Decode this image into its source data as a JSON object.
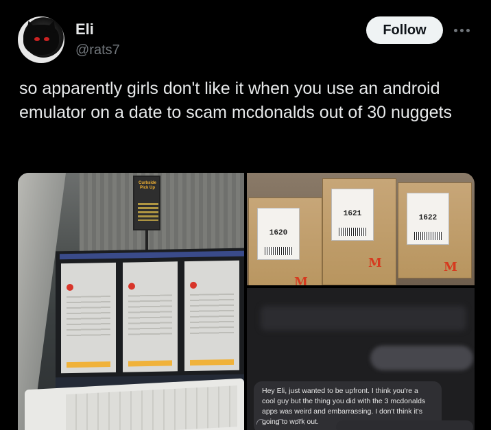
{
  "post": {
    "author_name": "Eli",
    "author_handle": "@rats7",
    "follow_label": "Follow",
    "more_icon": "more-horizontal-icon",
    "text": "so apparently girls don't like it when you use an android emulator on a date to scam mcdonalds out of 30 nuggets"
  },
  "media": {
    "left_photo": {
      "sign_text": "Curbside Pick Up"
    },
    "bags_photo": {
      "order_numbers": [
        "1620",
        "1621",
        "1622"
      ],
      "logo_glyph": "M"
    },
    "chat_photo": {
      "message": "Hey Eli, just wanted to be upfront. I think you're a cool guy but the thing you did with the 3 mcdonalds apps was weird and embarrassing. I don't think it's going to work out."
    }
  },
  "colors": {
    "background": "#000000",
    "text_primary": "#e7e9ea",
    "text_secondary": "#71767b",
    "follow_bg": "#eff3f4",
    "mcdonalds_red": "#d63a1f"
  }
}
